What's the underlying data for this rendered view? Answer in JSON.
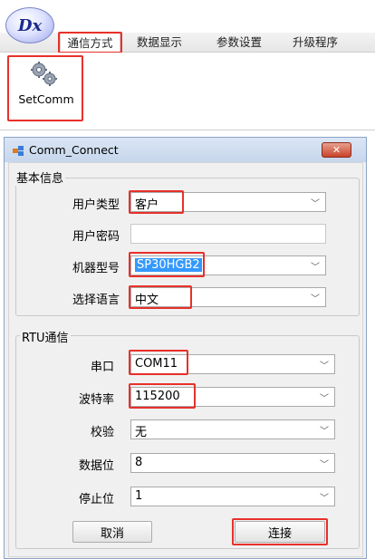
{
  "app": {
    "logo_text": "Dx"
  },
  "tabs": [
    {
      "label": "通信方式"
    },
    {
      "label": "数据显示"
    },
    {
      "label": "参数设置"
    },
    {
      "label": "升级程序"
    }
  ],
  "ribbon": {
    "setcomm_label": "SetComm"
  },
  "dialog": {
    "title": "Comm_Connect",
    "close_glyph": "✕",
    "basic_group": {
      "title": "基本信息",
      "user_type_label": "用户类型",
      "user_type_value": "客户",
      "password_label": "用户密码",
      "password_value": "",
      "model_label": "机器型号",
      "model_value": "SP30HGB2",
      "language_label": "选择语言",
      "language_value": "中文"
    },
    "rtu_group": {
      "title": "RTU通信",
      "port_label": "串口",
      "port_value": "COM11",
      "baud_label": "波特率",
      "baud_value": "115200",
      "parity_label": "校验",
      "parity_value": "无",
      "databits_label": "数据位",
      "databits_value": "8",
      "stopbits_label": "停止位",
      "stopbits_value": "1"
    },
    "cancel_label": "取消",
    "connect_label": "连接"
  },
  "colors": {
    "highlight": "#e8302a",
    "selection": "#3399ff",
    "titlebar": "#c6d6ec"
  }
}
